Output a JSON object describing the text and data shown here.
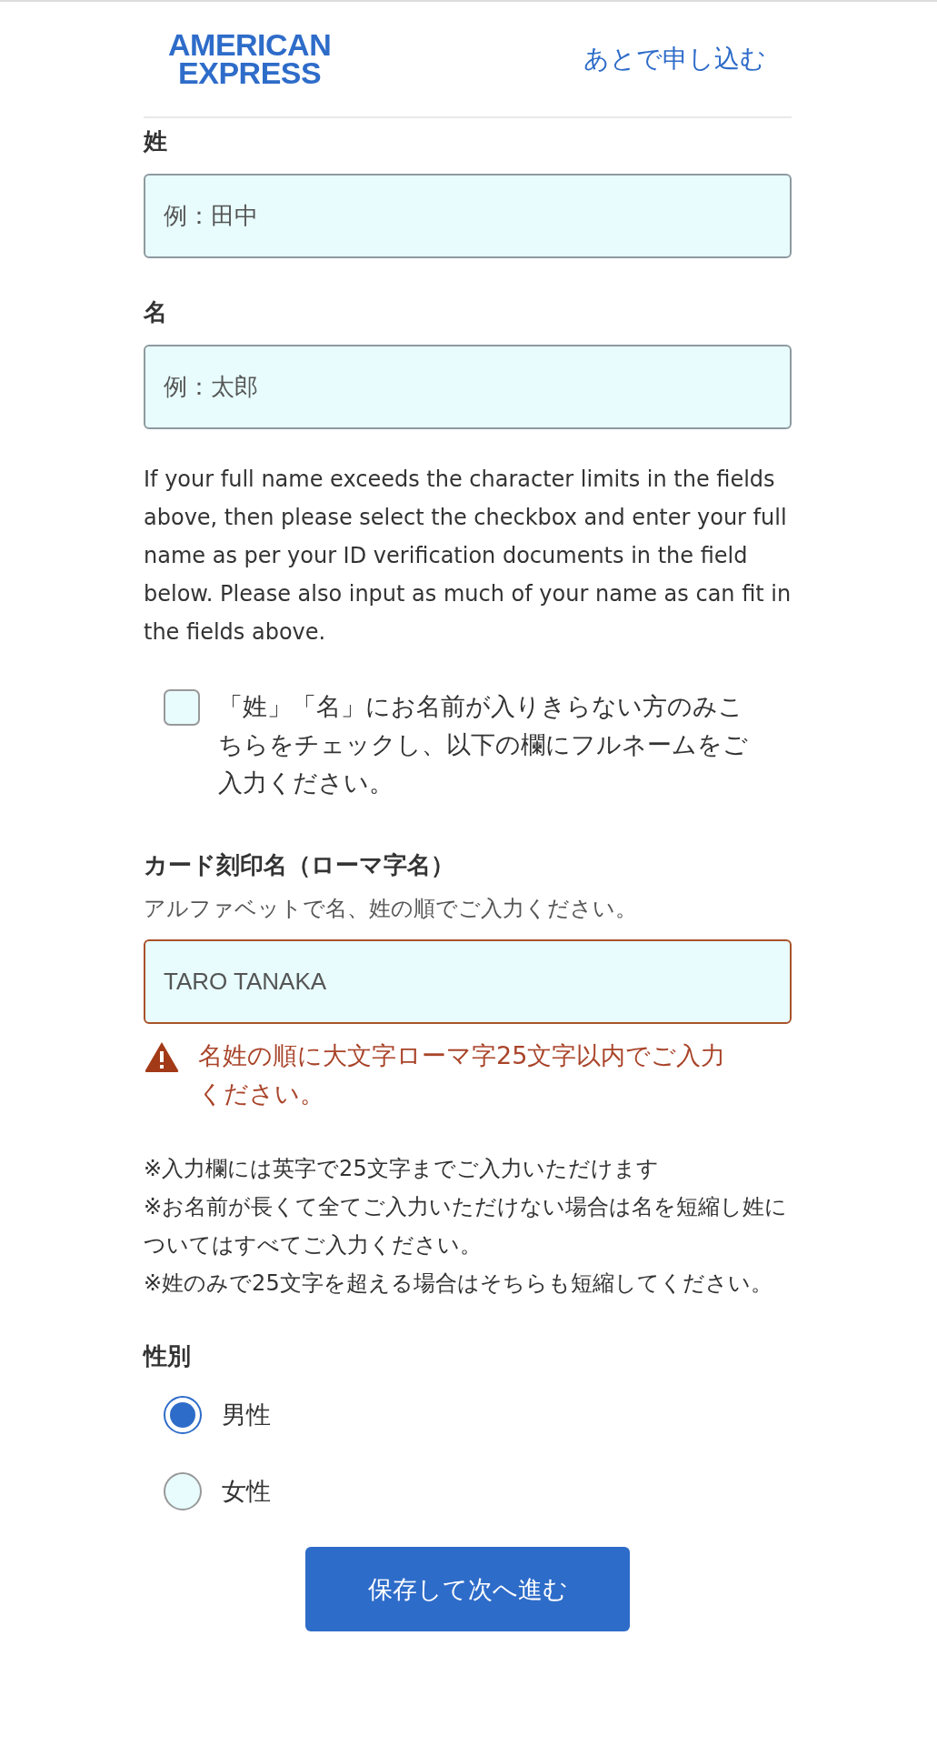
{
  "header": {
    "logo": [
      "AMERICAN",
      "EXPRESS"
    ],
    "apply_later_link": "あとで申し込む"
  },
  "name_fields": [
    {
      "label": "姓",
      "placeholder": "例：田中"
    },
    {
      "label": "名",
      "placeholder": "例：太郎"
    }
  ],
  "full_name_note": "If your full name exceeds the character limits in the fields above, then please select the checkbox and enter your full name as per your ID verification documents in the field below. Please also input as much of your name as can fit in the fields above.",
  "full_name_checkbox": {
    "label": "「姓」「名」にお名前が入りきらない方のみこちらをチェックし、以下の欄にフルネームをご入力ください。",
    "checked": false
  },
  "card_name": {
    "label": "カード刻印名（ローマ字名）",
    "hint": "アルファベットで名、姓の順でご入力ください。",
    "value": "TARO TANAKA",
    "error": "名姓の順に大文字ローマ字25文字以内でご入力ください。"
  },
  "notes": [
    "※入力欄には英字で25文字までご入力いただけます",
    "※お名前が長くて全てご入力いただけない場合は名を短縮し姓についてはすべてご入力ください。",
    "※姓のみで25文字を超える場合はそちらも短縮してください。"
  ],
  "gender": {
    "label": "性別",
    "options": [
      {
        "label": "男性",
        "selected": true
      },
      {
        "label": "女性",
        "selected": false
      }
    ]
  },
  "submit_button": "保存して次へ進む"
}
